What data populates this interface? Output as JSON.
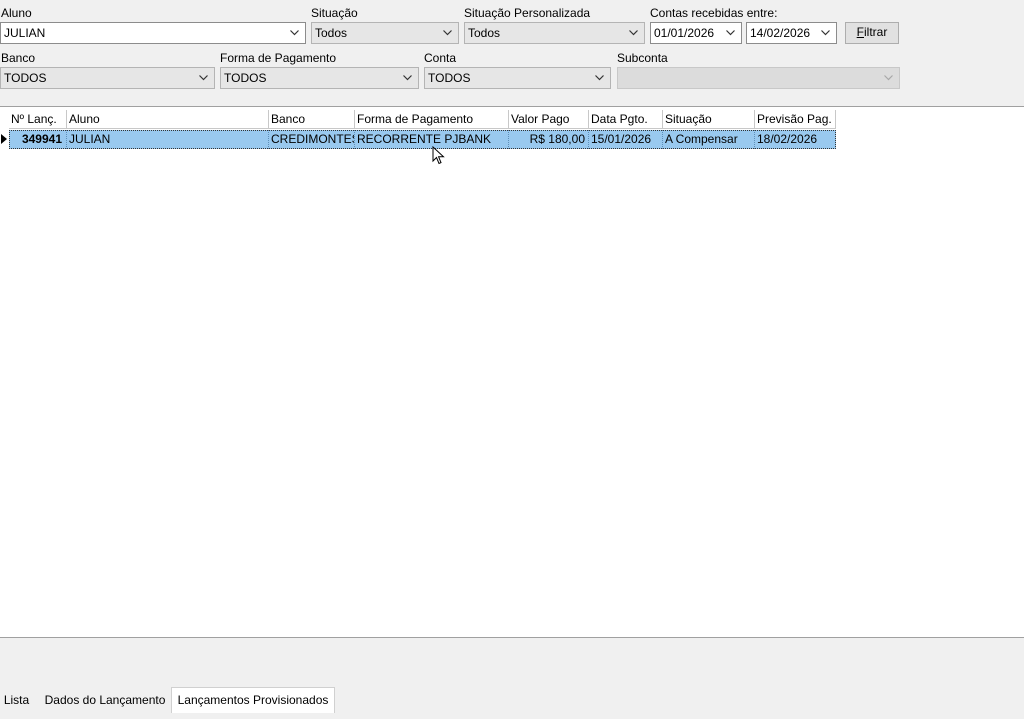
{
  "filters": {
    "aluno": {
      "label": "Aluno",
      "value": "JULIAN"
    },
    "situacao": {
      "label": "Situação",
      "value": "Todos"
    },
    "situacao_personalizada": {
      "label": "Situação Personalizada",
      "value": "Todos"
    },
    "contas_recebidas": {
      "label": "Contas recebidas entre:",
      "date_from": "01/01/2026",
      "date_to": "14/02/2026"
    },
    "filtrar_button": {
      "label_first": "F",
      "label_rest": "iltrar"
    },
    "banco": {
      "label": "Banco",
      "value": "TODOS"
    },
    "forma_pagamento": {
      "label": "Forma de Pagamento",
      "value": "TODOS"
    },
    "conta": {
      "label": "Conta",
      "value": "TODOS"
    },
    "subconta": {
      "label": "Subconta",
      "value": ""
    }
  },
  "grid": {
    "columns": [
      "Nº Lanç.",
      "Aluno",
      "Banco",
      "Forma de Pagamento",
      "Valor Pago",
      "Data Pgto.",
      "Situação",
      "Previsão Pag."
    ],
    "rows": [
      {
        "numero": "349941",
        "aluno": "JULIAN",
        "banco": "CREDIMONTES",
        "forma_pagamento": "RECORRENTE PJBANK",
        "valor_pago": "R$ 180,00",
        "data_pgto": "15/01/2026",
        "situacao": "A Compensar",
        "previsao_pag": "18/02/2026",
        "selected": true
      }
    ]
  },
  "tabs": [
    "Lista",
    "Dados do Lançamento",
    "Lançamentos Provisionados"
  ],
  "active_tab": "Lançamentos Provisionados",
  "icons": [
    "chevron-down-icon",
    "row-indicator-icon",
    "mouse-cursor-icon"
  ]
}
